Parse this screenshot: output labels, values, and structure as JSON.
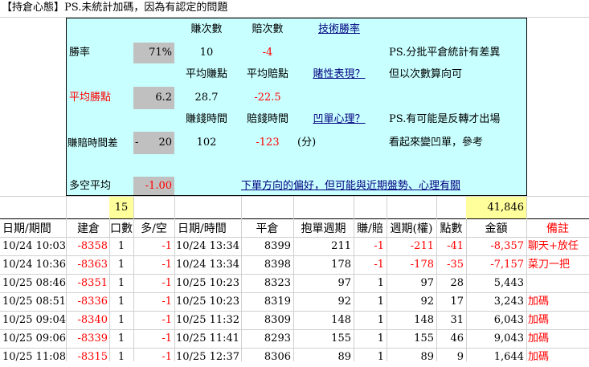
{
  "title": "【持倉心態】PS.未統計加碼，因為有認定的問題",
  "summary": {
    "win_rate_label": "勝率",
    "win_rate_value": "71%",
    "win_count_header": "賺次數",
    "loss_count_header": "賠次數",
    "win_count": "10",
    "loss_count": "-4",
    "tech_link": "技術勝率",
    "note1": "PS.分批平倉統計有差異",
    "avg_win_header": "平均賺點",
    "avg_loss_header": "平均賠點",
    "gamble_link": "賭性表現？",
    "note2": "但以次數算向可",
    "avg_win_label": "平均勝點",
    "avg_win_value": "6.2",
    "avg_win": "28.7",
    "avg_loss": "-22.5",
    "win_time_header": "賺錢時間",
    "loss_time_header": "賠錢時間",
    "dip_link": "凹單心理？",
    "note3": "PS.有可能是反轉才出場",
    "time_diff_label": "賺賠時間差",
    "time_diff_sign": "-",
    "time_diff_value": "20",
    "win_time": "102",
    "loss_time": "-123",
    "unit_minutes": "(分)",
    "note4": "看起來變凹單，參考",
    "long_short_label": "多空平均",
    "long_short_value": "-1.00",
    "bias_link": "下單方向的偏好，但可能與近期盤勢、心理有關"
  },
  "totals": {
    "lots": "15",
    "amount": "41,846"
  },
  "columns": [
    "日期/期間",
    "建倉",
    "口數",
    "多/空",
    "日期/時間",
    "平倉",
    "抱單週期",
    "賺/賠",
    "週期(權)",
    "點數",
    "金額",
    "備註"
  ],
  "rows": [
    {
      "open_time": "10/24 10:03",
      "open_price": "-8358",
      "lots": "1",
      "dir": "-1",
      "close_time": "10/24 13:34",
      "close_price": "8399",
      "hold": "211",
      "wl": "-1",
      "weighted": "-211",
      "points": "-41",
      "amount": "-8,357",
      "note": "聊天+放任"
    },
    {
      "open_time": "10/24 10:36",
      "open_price": "-8363",
      "lots": "1",
      "dir": "-1",
      "close_time": "10/24 13:34",
      "close_price": "8398",
      "hold": "178",
      "wl": "-1",
      "weighted": "-178",
      "points": "-35",
      "amount": "-7,157",
      "note": "菜刀一把"
    },
    {
      "open_time": "10/25 08:46",
      "open_price": "-8351",
      "lots": "1",
      "dir": "-1",
      "close_time": "10/25 10:23",
      "close_price": "8323",
      "hold": "97",
      "wl": "1",
      "weighted": "97",
      "points": "28",
      "amount": "5,443",
      "note": ""
    },
    {
      "open_time": "10/25 08:51",
      "open_price": "-8336",
      "lots": "1",
      "dir": "-1",
      "close_time": "10/25 10:23",
      "close_price": "8319",
      "hold": "92",
      "wl": "1",
      "weighted": "92",
      "points": "17",
      "amount": "3,243",
      "note": "加碼"
    },
    {
      "open_time": "10/25 09:04",
      "open_price": "-8340",
      "lots": "1",
      "dir": "-1",
      "close_time": "10/25 11:32",
      "close_price": "8309",
      "hold": "148",
      "wl": "1",
      "weighted": "148",
      "points": "31",
      "amount": "6,043",
      "note": "加碼"
    },
    {
      "open_time": "10/25 09:06",
      "open_price": "-8339",
      "lots": "1",
      "dir": "-1",
      "close_time": "10/25 11:41",
      "close_price": "8293",
      "hold": "155",
      "wl": "1",
      "weighted": "155",
      "points": "46",
      "amount": "9,043",
      "note": "加碼"
    },
    {
      "open_time": "10/25 11:08",
      "open_price": "-8315",
      "lots": "1",
      "dir": "-1",
      "close_time": "10/25 12:37",
      "close_price": "8306",
      "hold": "89",
      "wl": "1",
      "weighted": "89",
      "points": "9",
      "amount": "1,644",
      "note": "加碼"
    }
  ],
  "colors": {
    "cyan": "#c8ffff",
    "gray": "#c0c0c0",
    "yellow": "#ffff9c",
    "red": "#ff0000"
  }
}
